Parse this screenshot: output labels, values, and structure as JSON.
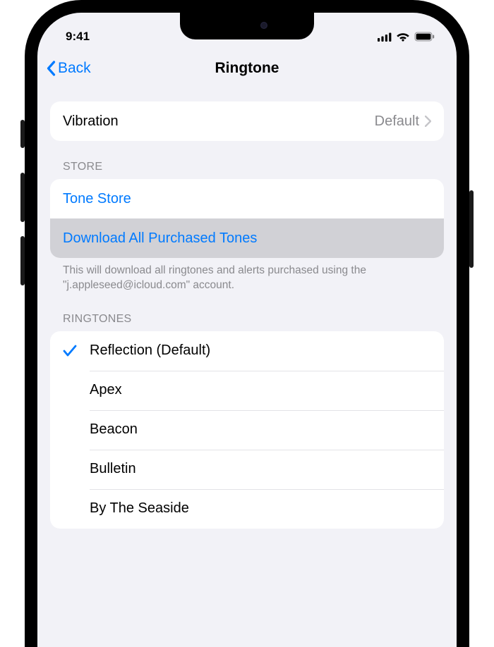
{
  "status": {
    "time": "9:41"
  },
  "nav": {
    "back_label": "Back",
    "title": "Ringtone"
  },
  "vibration": {
    "label": "Vibration",
    "value": "Default"
  },
  "store": {
    "header": "STORE",
    "tone_store": "Tone Store",
    "download_all": "Download All Purchased Tones",
    "footer": "This will download all ringtones and alerts purchased using the \"j.appleseed@icloud.com\" account."
  },
  "ringtones": {
    "header": "RINGTONES",
    "items": [
      {
        "label": "Reflection (Default)",
        "selected": true
      },
      {
        "label": "Apex",
        "selected": false
      },
      {
        "label": "Beacon",
        "selected": false
      },
      {
        "label": "Bulletin",
        "selected": false
      },
      {
        "label": "By The Seaside",
        "selected": false
      }
    ]
  }
}
